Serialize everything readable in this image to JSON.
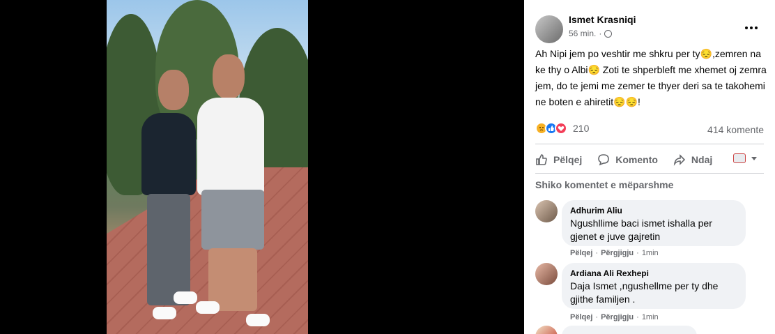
{
  "post": {
    "author": "Ismet Krasniqi",
    "time": "56 min.",
    "text": "Ah Nipi jem po veshtir me shkru per ty😔,zemren na ke thy o Albi😔 Zoti te shperbleft me xhemet oj zemra jem, do te jemi me zemer te thyer deri sa te takohemi ne boten e ahiretit😔😔!",
    "reaction_count": "210",
    "comment_count": "414 komente",
    "reactions": [
      "sad-reaction",
      "like-reaction",
      "love-reaction"
    ]
  },
  "actions": {
    "like": "Pëlqej",
    "comment": "Komento",
    "share": "Ndaj"
  },
  "comments_header": "Shiko komentet e mëparshme",
  "comments": [
    {
      "name": "Adhurim Aliu",
      "text": "Ngushllime baci ismet ishalla per gjenet e juve gajretin",
      "like": "Pëlqej",
      "reply": "Përgjigju",
      "time": "1min"
    },
    {
      "name": "Ardiana Ali Rexhepi",
      "text": "Daja Ismet ,ngushellme per ty dhe gjithe familjen .",
      "like": "Pëlqej",
      "reply": "Përgjigju",
      "time": "1min"
    }
  ],
  "colors": {
    "viewer_bg": "#000000",
    "panel_bg": "#ffffff",
    "text_primary": "#050505",
    "text_secondary": "#65676b",
    "bubble_bg": "#f0f2f5",
    "like_blue": "#1877f2",
    "love_red": "#f33e58",
    "sad_yellow": "#f7b125"
  }
}
